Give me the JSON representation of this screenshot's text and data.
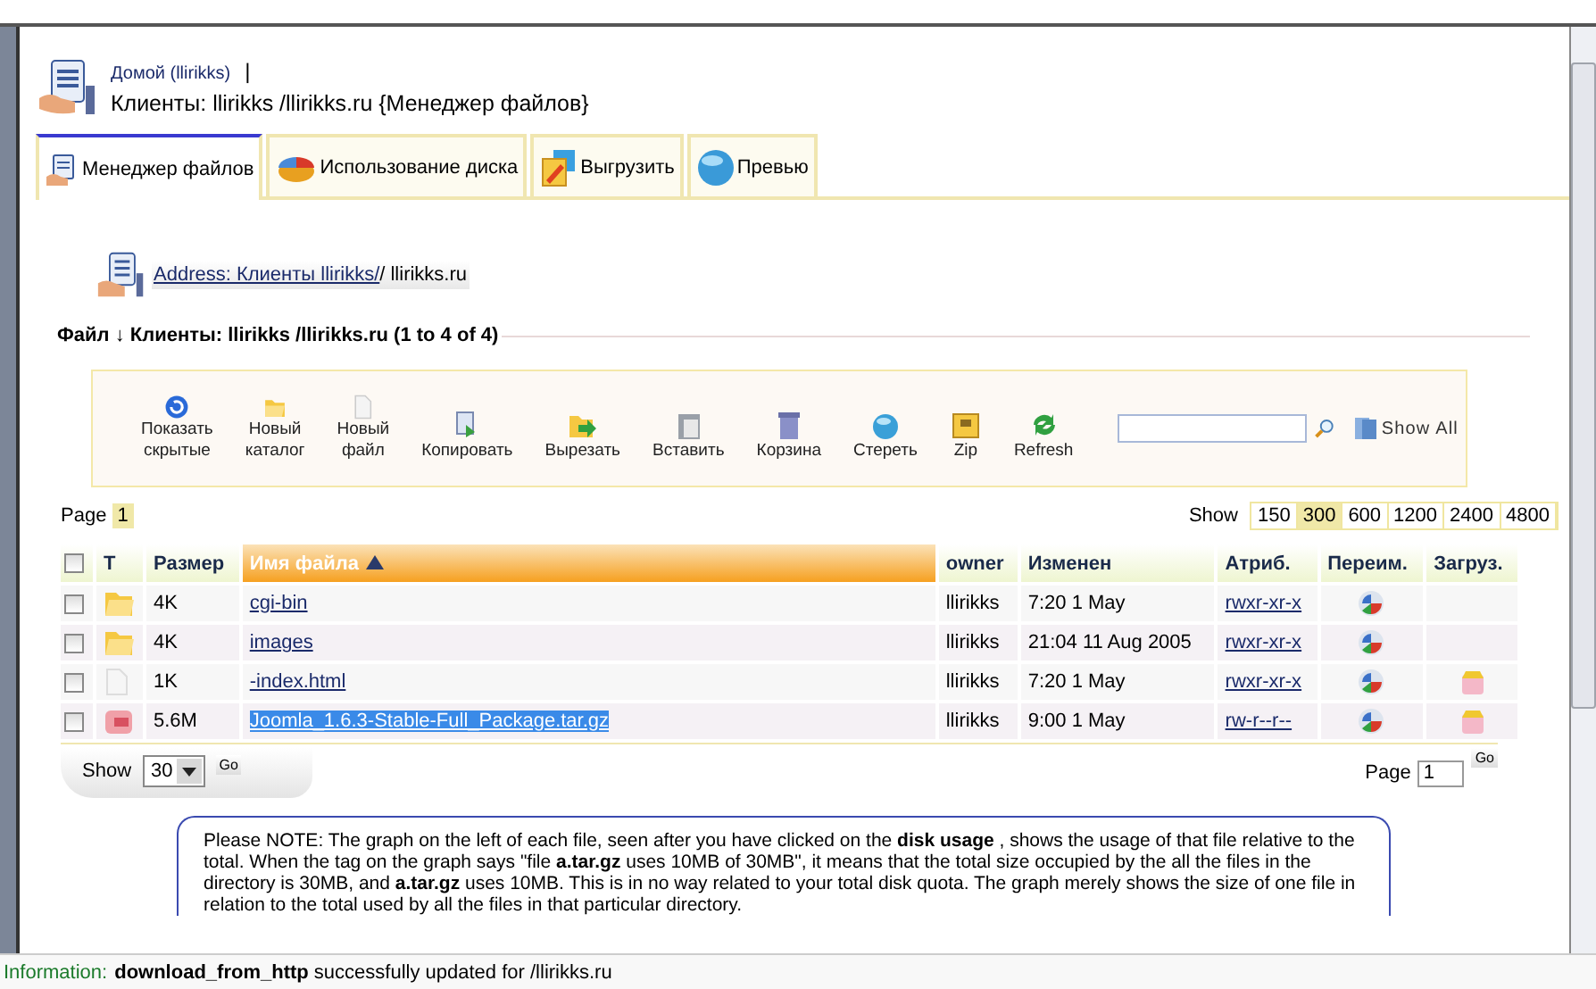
{
  "header": {
    "home_link": "Домой (llirikks)",
    "separator": "|",
    "title": "Клиенты: llirikks /llirikks.ru {Менеджер файлов}"
  },
  "tabs": [
    {
      "label": "Менеджер файлов",
      "selected": true
    },
    {
      "label": "Использование диска",
      "selected": false
    },
    {
      "label": "Выгрузить",
      "selected": false
    },
    {
      "label": "Превью",
      "selected": false
    }
  ],
  "breadcrumb": {
    "link": "Address: Клиенты llirikks/",
    "rest": "/ llirikks.ru"
  },
  "section_title": "Файл ↓ Клиенты: llirikks /llirikks.ru (1 to 4 of 4)",
  "toolbar": {
    "actions": [
      {
        "kind": "refresh",
        "lines": [
          "Показать",
          "скрытые"
        ]
      },
      {
        "kind": "folder",
        "lines": [
          "Новый",
          "каталог"
        ]
      },
      {
        "kind": "file",
        "lines": [
          "Новый",
          "файл"
        ]
      },
      {
        "kind": "copy",
        "lines": [
          "Копировать"
        ]
      },
      {
        "kind": "move",
        "lines": [
          "Вырезать"
        ]
      },
      {
        "kind": "paste",
        "lines": [
          "Вставить"
        ]
      },
      {
        "kind": "trash",
        "lines": [
          "Корзина"
        ]
      },
      {
        "kind": "erase",
        "lines": [
          "Стереть"
        ]
      },
      {
        "kind": "zip",
        "lines": [
          "Zip"
        ]
      },
      {
        "kind": "reload",
        "lines": [
          "Refresh"
        ]
      }
    ],
    "show_all": "Show All"
  },
  "pager": {
    "page_label": "Page",
    "pages": [
      {
        "label": "1",
        "selected": true
      }
    ],
    "show_label": "Show",
    "show_options": [
      {
        "label": "150",
        "selected": false
      },
      {
        "label": "300",
        "selected": true
      },
      {
        "label": "600",
        "selected": false
      },
      {
        "label": "1200",
        "selected": false
      },
      {
        "label": "2400",
        "selected": false
      },
      {
        "label": "4800",
        "selected": false
      }
    ]
  },
  "table": {
    "select_all_checked": false,
    "columns": [
      {
        "label": "T",
        "sorted": false
      },
      {
        "label": "Размер",
        "sorted": false
      },
      {
        "label": "Имя файла",
        "sorted": true
      },
      {
        "label": "owner",
        "sorted": false
      },
      {
        "label": "Изменен",
        "sorted": false
      },
      {
        "label": "Атриб.",
        "sorted": false
      },
      {
        "label": "Переим.",
        "sorted": false
      },
      {
        "label": "Загруз.",
        "sorted": false
      }
    ],
    "rows": [
      {
        "checked": false,
        "kind": "folder",
        "size": "4K",
        "name": "cgi-bin",
        "selected": false,
        "owner": "llirikks",
        "modified": "7:20 1 May",
        "perms": "rwxr-xr-x",
        "downloadable": false
      },
      {
        "checked": false,
        "kind": "folder",
        "size": "4K",
        "name": "images",
        "selected": false,
        "owner": "llirikks",
        "modified": "21:04 11 Aug 2005",
        "perms": "rwxr-xr-x",
        "downloadable": false
      },
      {
        "checked": false,
        "kind": "file",
        "size": "1K",
        "name": "-index.html",
        "selected": false,
        "owner": "llirikks",
        "modified": "7:20 1 May",
        "perms": "rwxr-xr-x",
        "downloadable": true
      },
      {
        "checked": false,
        "kind": "archive",
        "size": "5.6M",
        "name": "Joomla_1.6.3-Stable-Full_Package.tar.gz",
        "selected": true,
        "owner": "llirikks",
        "modified": "9:00 1 May",
        "perms": "rw-r--r--",
        "downloadable": true
      }
    ]
  },
  "footer": {
    "show_label": "Show",
    "per_page": "30",
    "go": "Go",
    "page_label": "Page",
    "page_value": "1",
    "page_go": "Go"
  },
  "note": "Please NOTE: The graph on the left of each file, seen after you have clicked on the **disk usage** , shows the usage of that file relative to the total. When the tag on the graph says \"file **a.tar.gz** uses 10MB of 30MB\", it means that the total size occupied by the all the files in the directory is 30MB, and **a.tar.gz** uses 10MB. This is in no way related to your total disk quota. The graph merely shows the size of one file in relation to the total used by all the files in that particular directory.",
  "status_bar": {
    "label": "Information:",
    "message": "**download_from_http** successfully updated for /llirikks.ru"
  }
}
